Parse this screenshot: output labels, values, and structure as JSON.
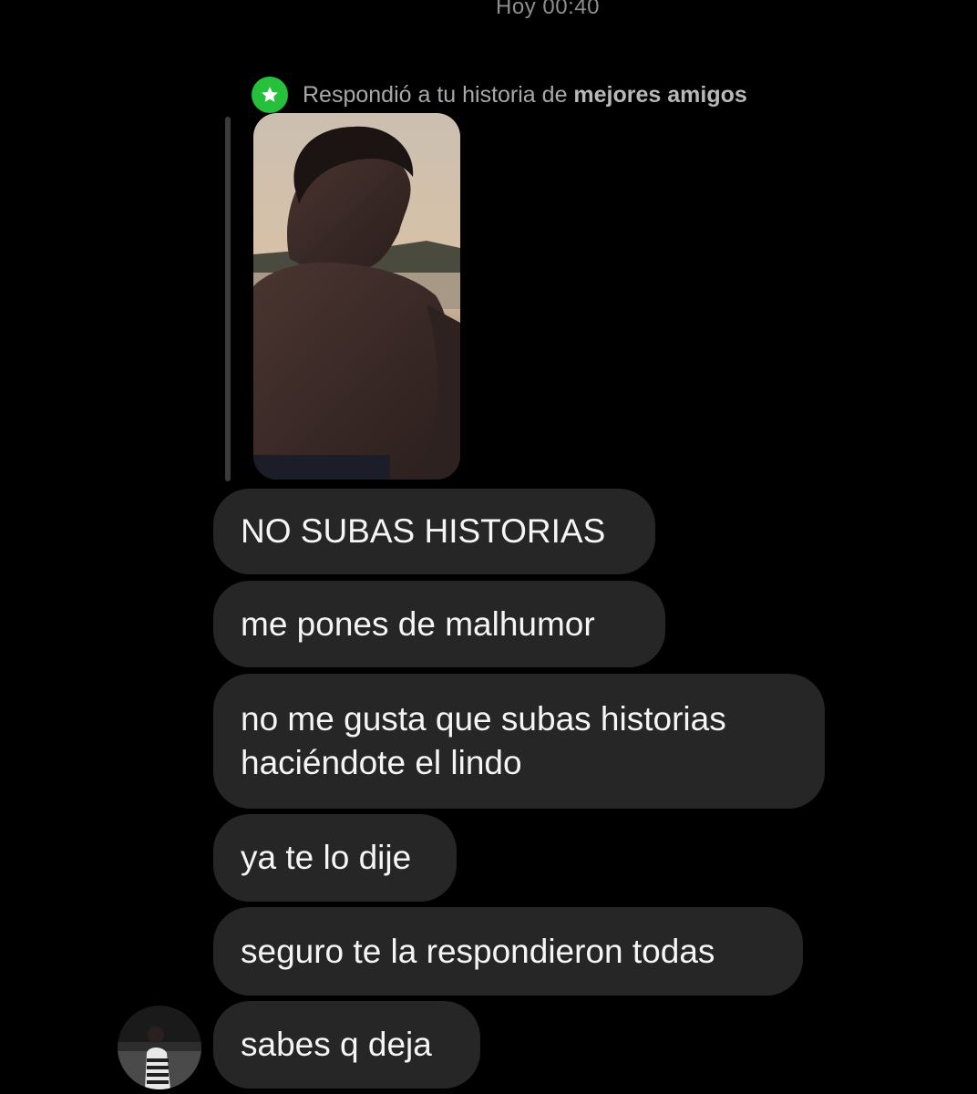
{
  "conversation": {
    "timestamp": "Hoy 00:40",
    "reply_context": {
      "prefix": "Respondió a tu historia de ",
      "highlight": "mejores amigos",
      "badge_icon": "star-icon",
      "badge_color": "#26c03c"
    },
    "story_preview": {
      "icon": "story-photo"
    },
    "messages": [
      {
        "text": "NO SUBAS HISTORIAS"
      },
      {
        "text": "me pones de malhumor"
      },
      {
        "text": "no me gusta que subas historias\nhaciéndote el lindo"
      },
      {
        "text": "ya te lo dije"
      },
      {
        "text": "seguro te la respondieron todas"
      },
      {
        "text": "sabes q deja"
      }
    ],
    "sender_avatar": {
      "icon": "avatar-photo"
    }
  },
  "theme": {
    "background": "#000000",
    "bubble_color": "#262626",
    "text_color": "#f5f5f5",
    "muted_text": "#8e8e8e"
  }
}
